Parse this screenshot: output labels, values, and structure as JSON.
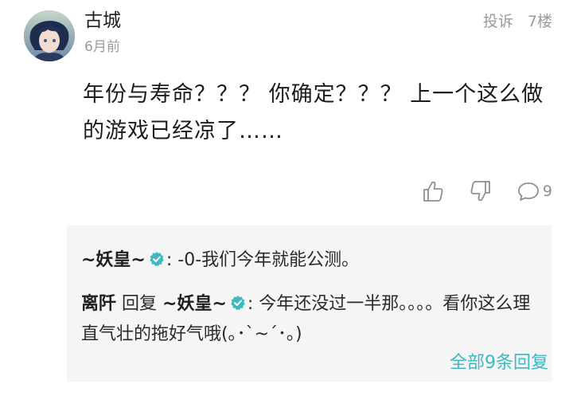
{
  "post": {
    "author": "古城",
    "time": "6月前",
    "report_label": "投诉",
    "floor": "7楼",
    "text": "年份与寿命？？？ 你确定？？？ 上一个这么做的游戏已经凉了……",
    "reply_count": "9"
  },
  "icons": {
    "like": "thumbs-up-icon",
    "dislike": "thumbs-down-icon",
    "reply": "comment-bubble-icon",
    "verified": "verified-badge-icon"
  },
  "colors": {
    "accent": "#3cb9c1",
    "muted": "#9b9b9b",
    "reply_bg": "#f5f5f5"
  },
  "replies": [
    {
      "author": "~妖皇~",
      "verified": true,
      "text": ": -0-我们今年就能公测。"
    },
    {
      "author": "离阡",
      "reply_word": "回复",
      "target": "~妖皇~",
      "target_verified": true,
      "text": ": 今年还没过一半那。。。。看你这么理直气壮的拖好气哦(｡･`~´･｡)"
    }
  ],
  "view_all_label": "全部9条回复"
}
